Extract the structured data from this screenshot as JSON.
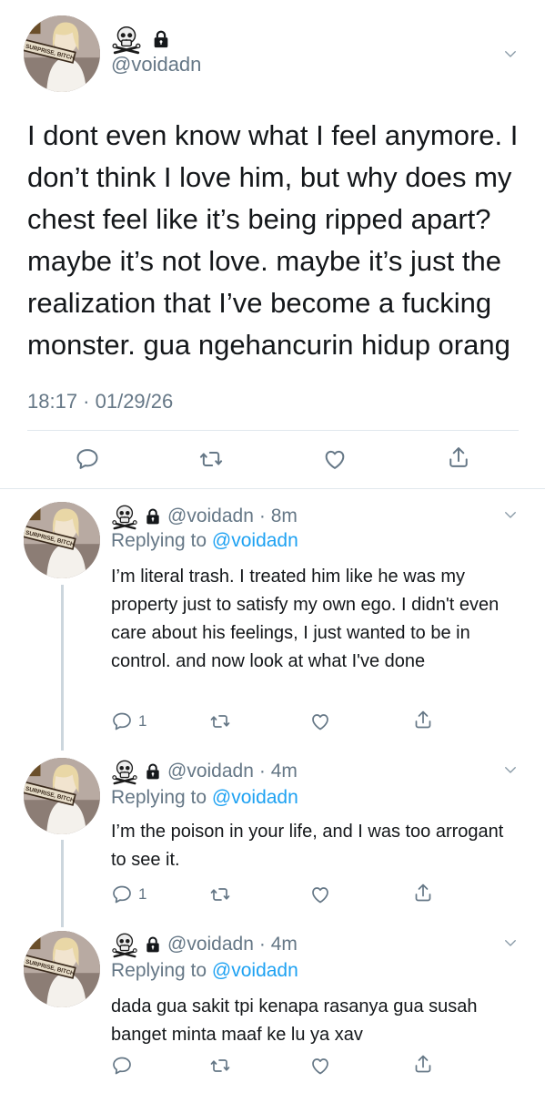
{
  "main_tweet": {
    "handle": "@voidadn",
    "badge_icons": [
      "skull-crossbones-icon",
      "lock-icon"
    ],
    "avatar_sign_text": "SURPRISE, BITCH",
    "text": "I dont even know what I feel anymore. I don’t think I love him, but why does my chest feel like it’s being ripped apart? maybe it’s not love. maybe it’s just the realization that I’ve become a fucking monster. gua ngehancurin hidup orang",
    "timestamp": "18:17 · 01/29/26",
    "actions": [
      "reply-icon",
      "retweet-icon",
      "like-icon",
      "share-icon"
    ]
  },
  "replies": [
    {
      "handle": "@voidadn",
      "time": "· 8m",
      "replying_label": "Replying to",
      "replying_to": "@voidadn",
      "text": "I’m literal trash. I treated him like he was my property just to satisfy my own ego. I didn't even care about his feelings, I just wanted to be in control. and now look at what I've done",
      "reply_count": "1"
    },
    {
      "handle": "@voidadn",
      "time": "· 4m",
      "replying_label": "Replying to",
      "replying_to": "@voidadn",
      "text": "I’m the poison in your life, and I was too arrogant to see it.",
      "reply_count": "1"
    },
    {
      "handle": "@voidadn",
      "time": "· 4m",
      "replying_label": "Replying to",
      "replying_to": "@voidadn",
      "text": "dada gua sakit tpi kenapa rasanya gua susah banget minta maaf ke lu ya xav",
      "reply_count": ""
    }
  ],
  "colors": {
    "accent": "#1da1f2",
    "muted": "#657786",
    "text": "#14171a",
    "divider": "#e1e8ed"
  }
}
